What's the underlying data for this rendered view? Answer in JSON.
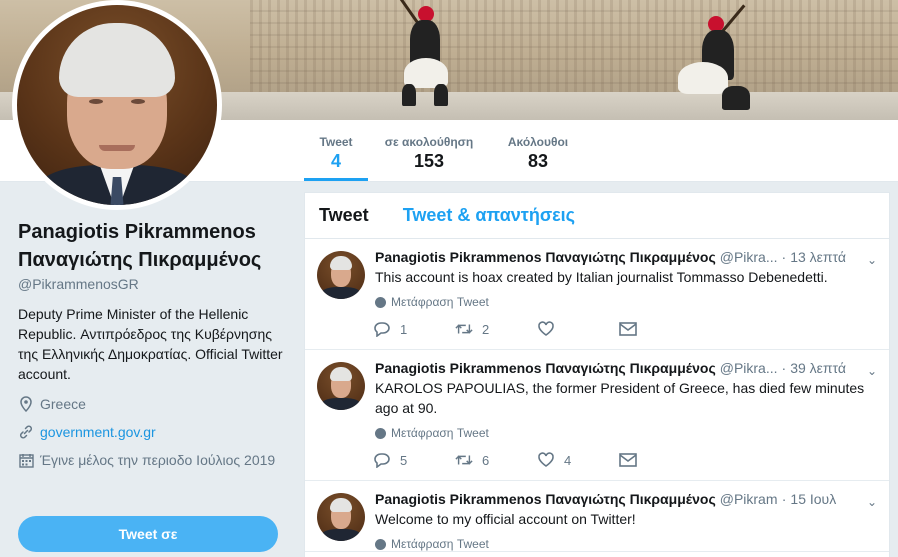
{
  "profile": {
    "name": "Panagiotis Pikrammenos Παναγιώτης Πικραμμένος",
    "handle": "@PikrammenosGR",
    "bio": "Deputy Prime Minister of the Hellenic Republic. Αντιπρόεδρος της Κυβέρνησης της Ελληνικής Δημοκρατίας. Official Twitter account.",
    "location": "Greece",
    "website": "government.gov.gr",
    "joined": "Έγινε μέλος την περιοδο Ιούλιος 2019",
    "tweet_button": "Tweet σε"
  },
  "stats": [
    {
      "label": "Tweet",
      "value": "4"
    },
    {
      "label": "σε ακολούθηση",
      "value": "153"
    },
    {
      "label": "Ακόλουθοι",
      "value": "83"
    }
  ],
  "tabs": [
    "Tweet",
    "Tweet & απαντήσεις"
  ],
  "tweets": [
    {
      "name": "Panagiotis Pikrammenos Παναγιώτης Πικραμμένος",
      "handle": "@Pikra...",
      "time": "13 λεπτά",
      "text": "This account is hoax created by Italian journalist Tommasso Debenedetti.",
      "translate": "Μετάφραση Tweet",
      "replies": "1",
      "retweets": "2",
      "likes": ""
    },
    {
      "name": "Panagiotis Pikrammenos Παναγιώτης Πικραμμένος",
      "handle": "@Pikra...",
      "time": "39 λεπτά",
      "text": "KAROLOS PAPOULIAS, the former President of Greece, has died few minutes ago at 90.",
      "translate": "Μετάφραση Tweet",
      "replies": "5",
      "retweets": "6",
      "likes": "4"
    },
    {
      "name": "Panagiotis Pikrammenos Παναγιώτης Πικραμμένος",
      "handle": "@Pikram...",
      "time": "15 Ιουλ",
      "text": "Welcome to my official account on Twitter!",
      "translate": "Μετάφραση Tweet",
      "replies": "",
      "retweets": "",
      "likes": ""
    }
  ],
  "icons": {
    "location": "map-pin-icon",
    "link": "link-icon",
    "calendar": "calendar-icon",
    "reply": "reply-icon",
    "retweet": "retweet-icon",
    "like": "heart-icon",
    "dm": "envelope-icon",
    "caret": "chevron-down-icon",
    "translate": "globe-icon"
  },
  "colors": {
    "accent": "#1da1f2",
    "link": "#1b95e0",
    "muted": "#657786",
    "button": "#4ab3f4",
    "background": "#e6ecf0"
  }
}
